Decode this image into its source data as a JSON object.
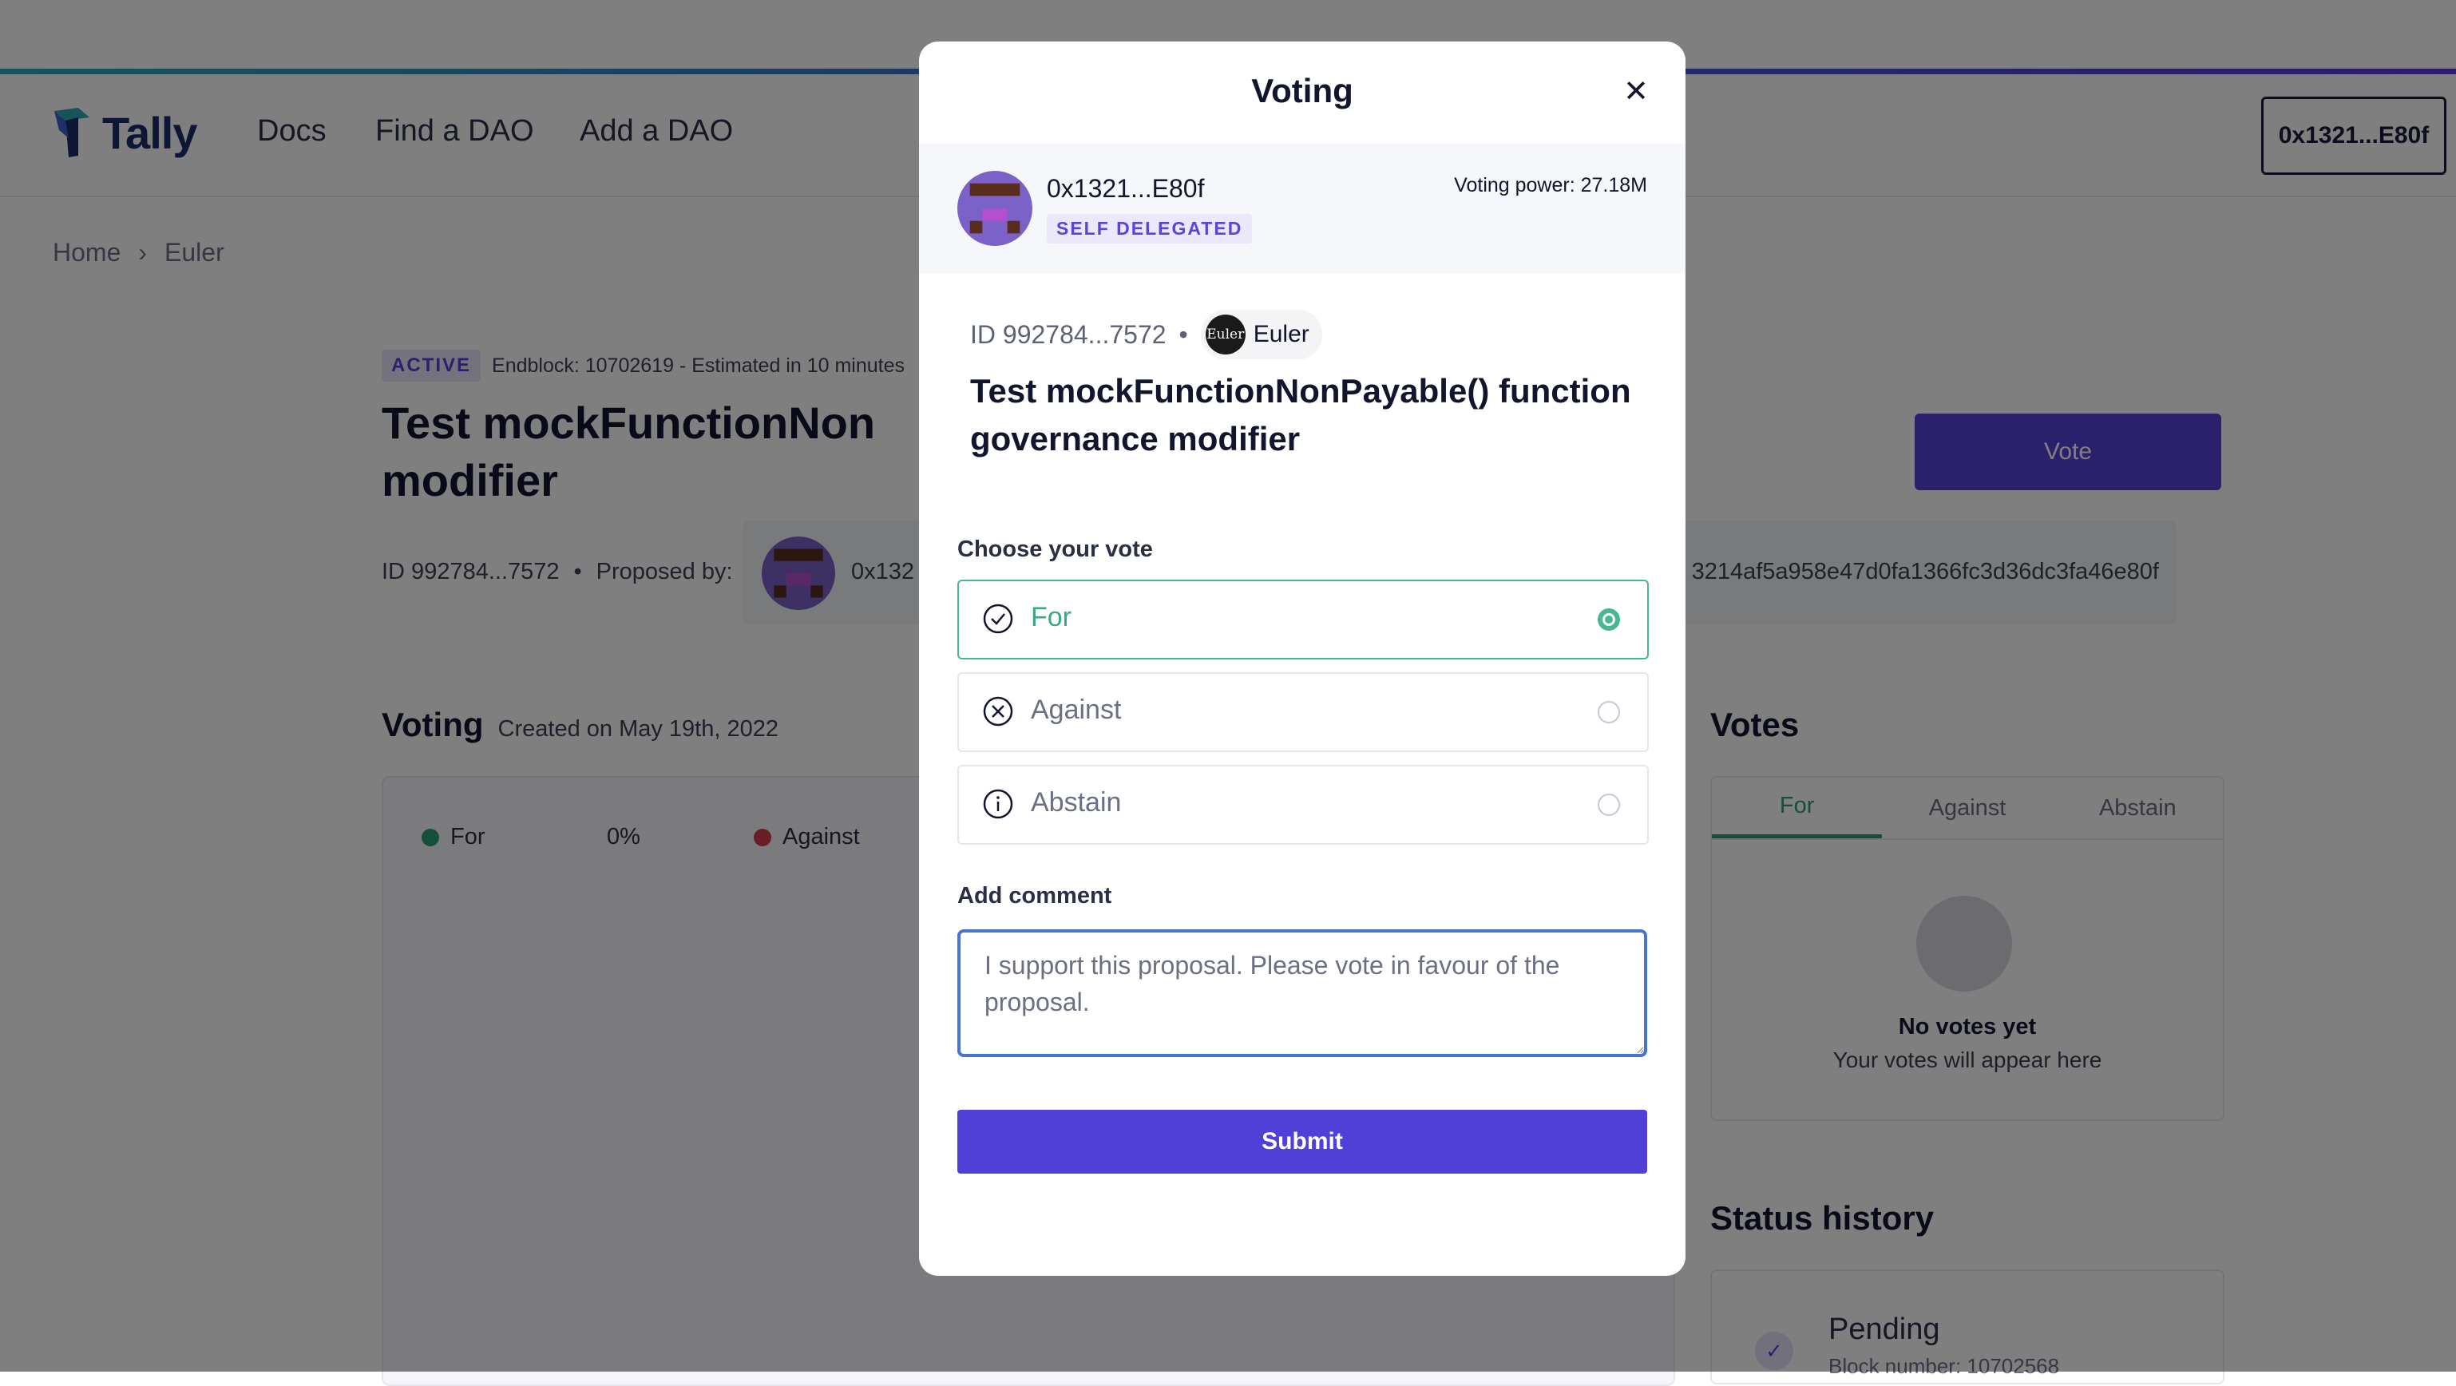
{
  "header": {
    "logo_text": "Tally",
    "nav": [
      "Docs",
      "Find a DAO",
      "Add a DAO"
    ],
    "wallet": "0x1321...E80f"
  },
  "breadcrumb": [
    "Home",
    "Euler"
  ],
  "proposal": {
    "status": "ACTIVE",
    "endblock": "Endblock: 10702619 - Estimated in 10 minutes",
    "title": "Test mockFunctionNon",
    "title_line2": "modifier",
    "vote_button": "Vote",
    "id": "ID 992784...7572",
    "proposed_by": "Proposed by:",
    "proposer_short": "0x132",
    "proposer_hash": "3214af5a958e47d0fa1366fc3d36dc3fa46e80f"
  },
  "voting_section": {
    "heading": "Voting",
    "created": "Created on May 19th, 2022",
    "legend": [
      {
        "label": "For",
        "color": "#2a9d74"
      },
      {
        "label": "0%",
        "color": ""
      },
      {
        "label": "Against",
        "color": "#d23c4d"
      }
    ]
  },
  "votes_panel": {
    "heading": "Votes",
    "tabs": [
      "For",
      "Against",
      "Abstain"
    ],
    "empty_title": "No votes yet",
    "empty_sub": "Your votes will appear here"
  },
  "status_history": {
    "heading": "Status history",
    "item_label": "Pending",
    "item_block": "Block number: 10702568"
  },
  "modal": {
    "title": "Voting",
    "close_icon": "close-icon",
    "voter_address": "0x1321...E80f",
    "voter_badge": "SELF DELEGATED",
    "voting_power": "Voting power: 27.18M",
    "proposal_id": "ID 992784...7572",
    "separator": "•",
    "dao_logo_text": "Euler",
    "dao_name": "Euler",
    "proposal_title": "Test mockFunctionNonPayable() function governance modifier",
    "choose_label": "Choose your vote",
    "options": [
      {
        "label": "For",
        "icon": "check-circle-icon",
        "selected": true
      },
      {
        "label": "Against",
        "icon": "x-circle-icon",
        "selected": false
      },
      {
        "label": "Abstain",
        "icon": "info-circle-icon",
        "selected": false
      }
    ],
    "comment_label": "Add comment",
    "comment_value": "I support this proposal. Please vote in favour of the proposal.",
    "submit": "Submit"
  },
  "colors": {
    "accent": "#5641d6",
    "for_green": "#46b88f",
    "focus_blue": "#4874d3"
  }
}
